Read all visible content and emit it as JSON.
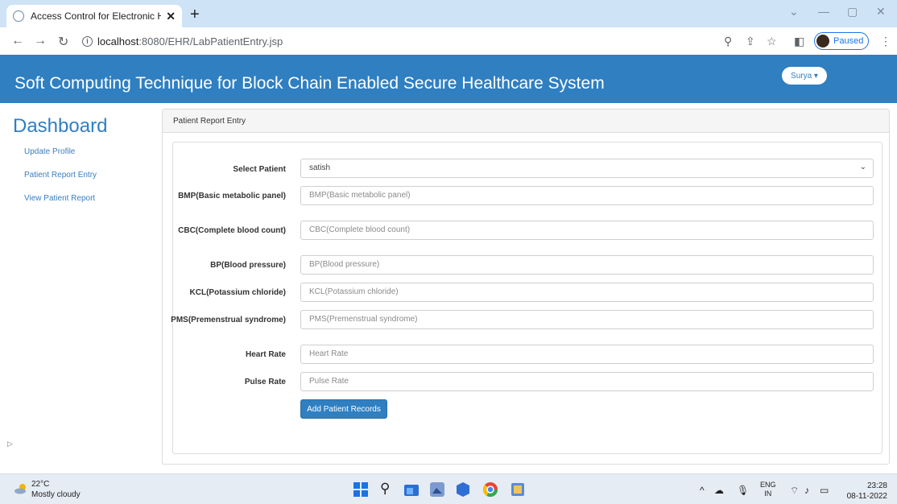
{
  "browser": {
    "tab_title": "Access Control for Electronic Hea",
    "tab_close": "✕",
    "new_tab": "+",
    "url_host": "localhost",
    "url_path": ":8080/EHR/LabPatientEntry.jsp",
    "profile_status": "Paused"
  },
  "header": {
    "title": "Soft Computing Technique for Block Chain Enabled Secure Healthcare System",
    "user": "Surya ▾"
  },
  "sidebar": {
    "heading": "Dashboard",
    "items": [
      {
        "label": "Update Profile"
      },
      {
        "label": "Patient Report Entry"
      },
      {
        "label": "View Patient Report"
      }
    ]
  },
  "panel": {
    "heading": "Patient Report Entry"
  },
  "form": {
    "fields": [
      {
        "label": "Select Patient",
        "value": "satish",
        "placeholder": ""
      },
      {
        "label": "BMP(Basic metabolic panel)",
        "value": "",
        "placeholder": "BMP(Basic metabolic panel)"
      },
      {
        "label": "CBC(Complete blood count)",
        "value": "",
        "placeholder": "CBC(Complete blood count)"
      },
      {
        "label": "BP(Blood pressure)",
        "value": "",
        "placeholder": "BP(Blood pressure)"
      },
      {
        "label": "KCL(Potassium chloride)",
        "value": "",
        "placeholder": "KCL(Potassium chloride)"
      },
      {
        "label": "PMS(Premenstrual syndrome)",
        "value": "",
        "placeholder": "PMS(Premenstrual syndrome)"
      },
      {
        "label": "Heart Rate",
        "value": "",
        "placeholder": "Heart Rate"
      },
      {
        "label": "Pulse Rate",
        "value": "",
        "placeholder": "Pulse Rate"
      }
    ],
    "submit_label": "Add Patient Records"
  },
  "taskbar": {
    "temperature": "22°C",
    "weather": "Mostly cloudy",
    "lang_top": "ENG",
    "lang_bottom": "IN",
    "time": "23:28",
    "date": "08-11-2022"
  },
  "colors": {
    "brand": "#2f7fc1",
    "link": "#3a7ec0"
  }
}
